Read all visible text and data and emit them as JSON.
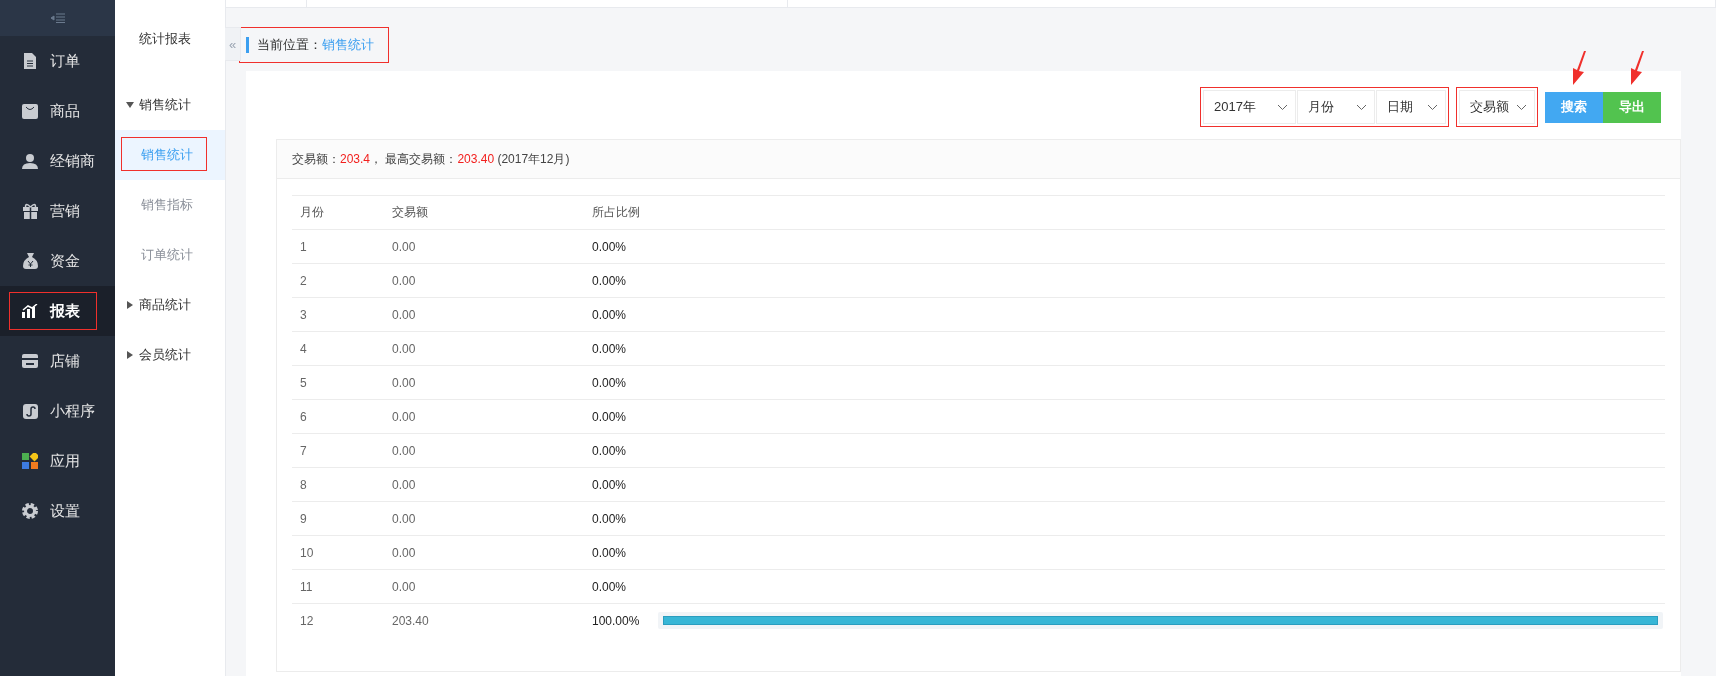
{
  "nav": {
    "items": [
      {
        "label": "订单",
        "selected": false,
        "highlighted": false
      },
      {
        "label": "商品",
        "selected": false,
        "highlighted": false
      },
      {
        "label": "经销商",
        "selected": false,
        "highlighted": false
      },
      {
        "label": "营销",
        "selected": false,
        "highlighted": false
      },
      {
        "label": "资金",
        "selected": false,
        "highlighted": false
      },
      {
        "label": "报表",
        "selected": true,
        "highlighted": true
      },
      {
        "label": "店铺",
        "selected": false,
        "highlighted": false
      },
      {
        "label": "小程序",
        "selected": false,
        "highlighted": false
      },
      {
        "label": "应用",
        "selected": false,
        "highlighted": false
      },
      {
        "label": "设置",
        "selected": false,
        "highlighted": false
      }
    ]
  },
  "subnav": {
    "title": "统计报表",
    "collapse": "«",
    "groups": [
      {
        "label": "销售统计",
        "expanded": true,
        "children": [
          {
            "label": "销售统计",
            "selected": true,
            "highlighted": true
          },
          {
            "label": "销售指标",
            "selected": false,
            "highlighted": false
          },
          {
            "label": "订单统计",
            "selected": false,
            "highlighted": false
          }
        ]
      },
      {
        "label": "商品统计",
        "expanded": false
      },
      {
        "label": "会员统计",
        "expanded": false
      }
    ]
  },
  "breadcrumb": {
    "label": "当前位置：",
    "current": "销售统计",
    "highlighted": true
  },
  "filters": {
    "date_group": {
      "highlighted": true,
      "selects": [
        {
          "value": "2017年"
        },
        {
          "value": "月份"
        },
        {
          "value": "日期"
        }
      ]
    },
    "type": {
      "value": "交易额",
      "highlighted": true
    },
    "buttons": [
      {
        "label": "搜索",
        "kind": "primary",
        "arrow": true
      },
      {
        "label": "导出",
        "kind": "success",
        "arrow": true
      }
    ]
  },
  "summary": {
    "total_label": "交易额：",
    "total_value": "203.4",
    "separator": "，",
    "max_label": "最高交易额：",
    "max_value": "203.40",
    "max_period": "(2017年12月)"
  },
  "table": {
    "columns": [
      "月份",
      "交易额",
      "所占比例"
    ],
    "rows": [
      {
        "month": "1",
        "amount": "0.00",
        "share": "0.00%"
      },
      {
        "month": "2",
        "amount": "0.00",
        "share": "0.00%"
      },
      {
        "month": "3",
        "amount": "0.00",
        "share": "0.00%"
      },
      {
        "month": "4",
        "amount": "0.00",
        "share": "0.00%"
      },
      {
        "month": "5",
        "amount": "0.00",
        "share": "0.00%"
      },
      {
        "month": "6",
        "amount": "0.00",
        "share": "0.00%"
      },
      {
        "month": "7",
        "amount": "0.00",
        "share": "0.00%"
      },
      {
        "month": "8",
        "amount": "0.00",
        "share": "0.00%"
      },
      {
        "month": "9",
        "amount": "0.00",
        "share": "0.00%"
      },
      {
        "month": "10",
        "amount": "0.00",
        "share": "0.00%"
      },
      {
        "month": "11",
        "amount": "0.00",
        "share": "0.00%"
      },
      {
        "month": "12",
        "amount": "203.40",
        "share": "100.00%",
        "level": 1
      }
    ]
  }
}
